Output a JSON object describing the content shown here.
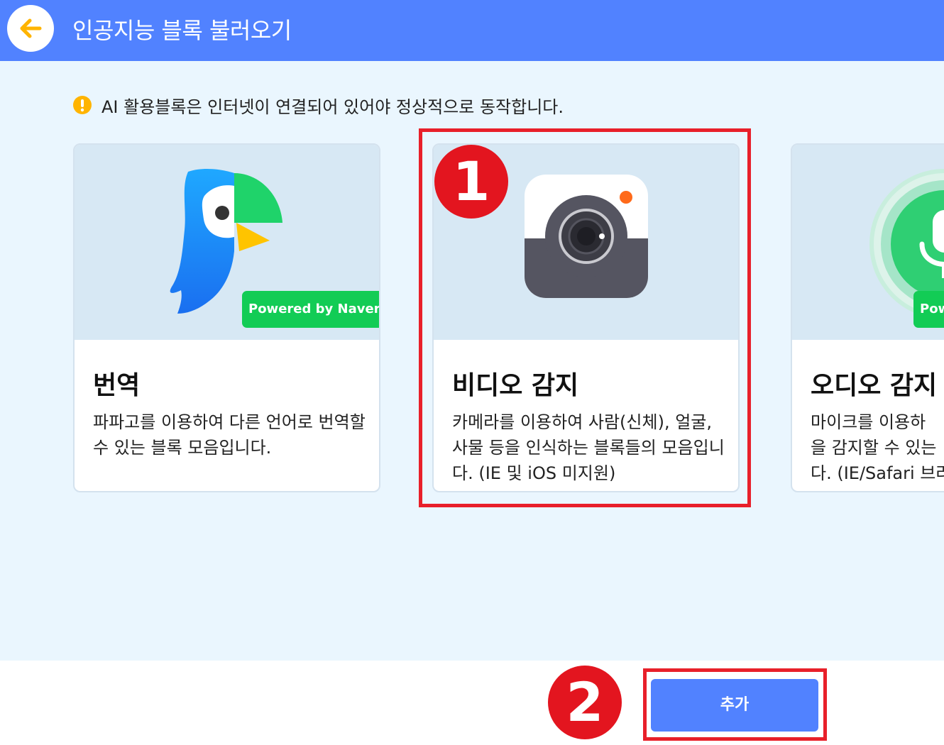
{
  "header": {
    "title": "인공지능 블록 불러오기",
    "back_icon": "arrow-left-icon"
  },
  "notice": {
    "icon": "warning-icon",
    "text": "AI 활용블록은 인터넷이 연결되어 있어야 정상적으로 동작합니다."
  },
  "cards": [
    {
      "title": "번역",
      "description": "파파고를 이용하여 다른 언어로 번역할 수 있는 블록 모음입니다.",
      "badge": "Powered by Naver",
      "icon": "papago-parrot-icon"
    },
    {
      "title": "비디오 감지",
      "description": "카메라를 이용하여 사람(신체), 얼굴, 사물 등을 인식하는 블록들의 모음입니다. (IE 및 iOS 미지원)",
      "icon": "camera-icon",
      "selected": true
    },
    {
      "title": "오디오 감지",
      "description": "마이크를 이용하\n을 감지할 수 있는\n다. (IE/Safari 브라",
      "badge": "Pow",
      "icon": "microphone-icon"
    }
  ],
  "steps": [
    "1",
    "2"
  ],
  "footer": {
    "add_label": "추가"
  },
  "colors": {
    "header": "#5182ff",
    "background": "#eaf6fe",
    "badge_green": "#12cc55",
    "highlight_red": "#e8202a",
    "accent_orange": "#ffb400"
  }
}
